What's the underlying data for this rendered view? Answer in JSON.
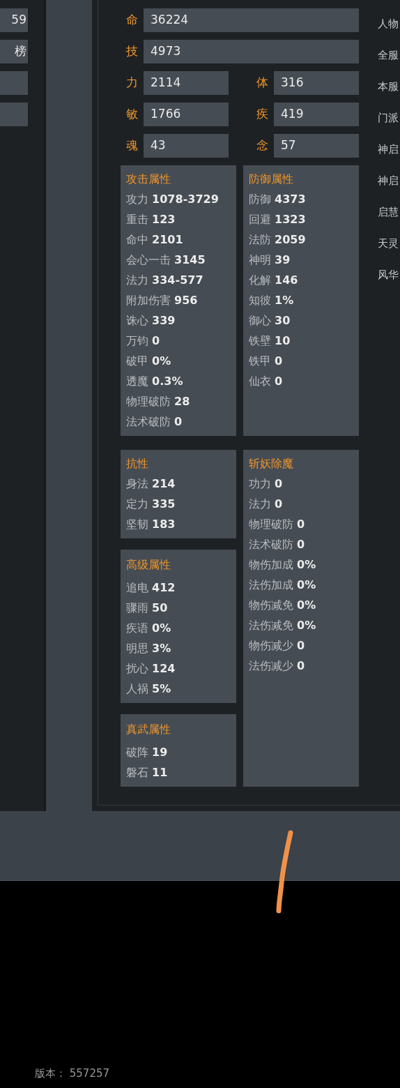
{
  "left_panel": {
    "values": [
      "59",
      "榜"
    ]
  },
  "base_stats": [
    {
      "cells": [
        {
          "label": "命",
          "value": "36224"
        }
      ]
    },
    {
      "cells": [
        {
          "label": "技",
          "value": "4973"
        }
      ]
    },
    {
      "cells": [
        {
          "label": "力",
          "value": "2114"
        },
        {
          "label": "体",
          "value": "316"
        }
      ]
    },
    {
      "cells": [
        {
          "label": "敏",
          "value": "1766"
        },
        {
          "label": "疾",
          "value": "419"
        }
      ]
    },
    {
      "cells": [
        {
          "label": "魂",
          "value": "43"
        },
        {
          "label": "念",
          "value": "57"
        }
      ]
    }
  ],
  "sections": [
    {
      "columns": [
        [
          {
            "title": "攻击属性",
            "items": [
              "攻力 **1078-3729**",
              "重击 **123**",
              "命中 **2101**",
              "会心一击 **3145**",
              "法力 **334-577**",
              "附加伤害 **956**",
              "诛心 **339**",
              "万钧 **0**",
              "破甲 **0%**",
              "透魔 **0.3%**",
              "物理破防 **28**",
              "法术破防 **0**"
            ]
          }
        ],
        [
          {
            "title": "防御属性",
            "items": [
              "防御 **4373**",
              "回避 **1323**",
              "法防 **2059**",
              "神明 **39**",
              "化解 **146**",
              "知彼 **1%**",
              "御心 **30**",
              "铁壁 **10**",
              "铁甲 **0**",
              "仙衣 **0**"
            ]
          }
        ]
      ]
    },
    {
      "columns": [
        [
          {
            "title": "抗性",
            "items": [
              "身法 **214**",
              "定力 **335**",
              "坚韧 **183**"
            ]
          },
          {
            "title": "高级属性",
            "items": [
              "追电 **412**",
              "骤雨 **50**",
              "疾语 **0%**",
              "明思 **3%**",
              "扰心 **124**",
              "人祸 **5%**"
            ]
          },
          {
            "title": "真武属性",
            "items": [
              "破阵 **19**",
              "磐石 **11**"
            ]
          }
        ],
        [
          {
            "title": "斩妖除魔",
            "items": [
              "功力 **0**",
              "法力 **0**",
              "物理破防 **0**",
              "法术破防 **0**",
              "物伤加成 **0%**",
              "法伤加成 **0%**",
              "物伤减免 **0%**",
              "法伤减免 **0%**",
              "物伤减少 **0**",
              "法伤减少 **0**"
            ]
          }
        ]
      ]
    }
  ],
  "right_list": [
    "人物",
    "全服",
    "本服",
    "门派",
    "神启",
    "神启",
    "启慧",
    "天灵",
    "风华"
  ],
  "version": "版本： 557257"
}
